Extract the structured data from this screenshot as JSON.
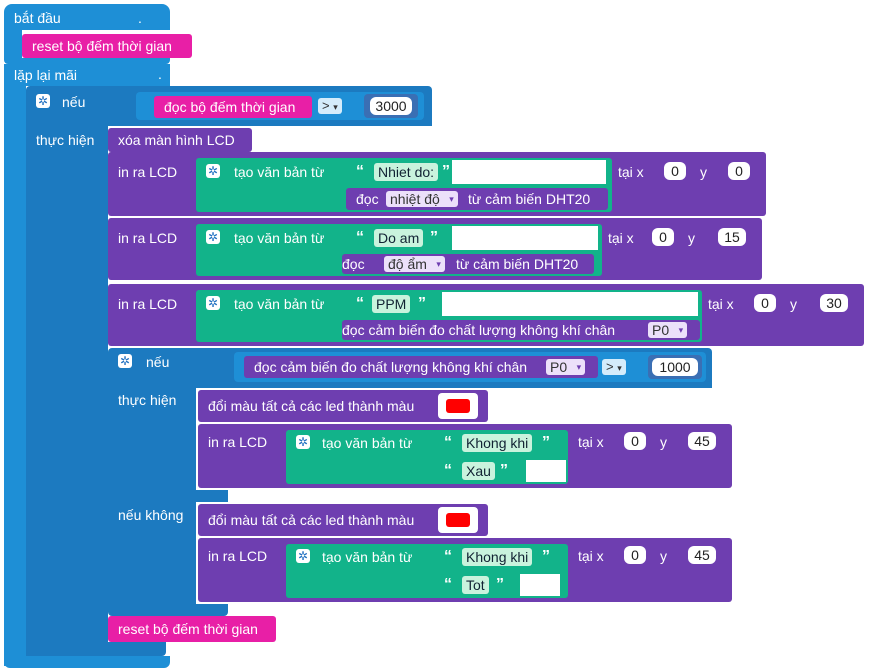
{
  "start": {
    "label": "bắt đầu",
    "dot": "."
  },
  "reset1": {
    "label": "reset bộ đếm thời gian"
  },
  "forever": {
    "label": "lặp lại mãi",
    "dot": "."
  },
  "if1": {
    "if_label": "nếu",
    "cond_label": "đọc bộ đếm thời gian",
    "op": ">",
    "value": "3000",
    "do_label": "thực hiện"
  },
  "clear": {
    "label": "xóa màn hình LCD"
  },
  "common": {
    "print": "in ra LCD",
    "create_text": "tạo văn bản từ",
    "at_x": "tại x",
    "y": "y",
    "open_quote": "“",
    "close_quote": "”",
    "arrow": "▾"
  },
  "lcd1": {
    "text": "Nhiet do:",
    "read_pre": "đọc",
    "dd": "nhiệt độ",
    "read_post": "từ cảm biến DHT20",
    "x": "0",
    "y": "0"
  },
  "lcd2": {
    "text": "Do am",
    "read_pre": "đọc",
    "dd": "độ ẩm",
    "read_post": "từ cảm biến DHT20",
    "x": "0",
    "y": "15"
  },
  "lcd3": {
    "text": "PPM",
    "read": "đọc cảm biến đo chất lượng không khí chân",
    "dd": "P0",
    "x": "0",
    "y": "30"
  },
  "if2": {
    "if_label": "nếu",
    "cond": "đọc cảm biến đo chất lượng không khí chân",
    "dd": "P0",
    "op": ">",
    "value": "1000",
    "do_label": "thực hiện",
    "else_label": "nếu không"
  },
  "led1": {
    "label": "đổi màu tất cả các led thành màu",
    "color": "#ff0000"
  },
  "lcd4": {
    "text1": "Khong khi",
    "text2": "Xau",
    "x": "0",
    "y": "45"
  },
  "led2": {
    "label": "đổi màu tất cả các led thành màu",
    "color": "#ff0000"
  },
  "lcd5": {
    "text1": "Khong khi",
    "text2": "Tot",
    "x": "0",
    "y": "45"
  },
  "reset2": {
    "label": "reset bộ đếm thời gian"
  }
}
